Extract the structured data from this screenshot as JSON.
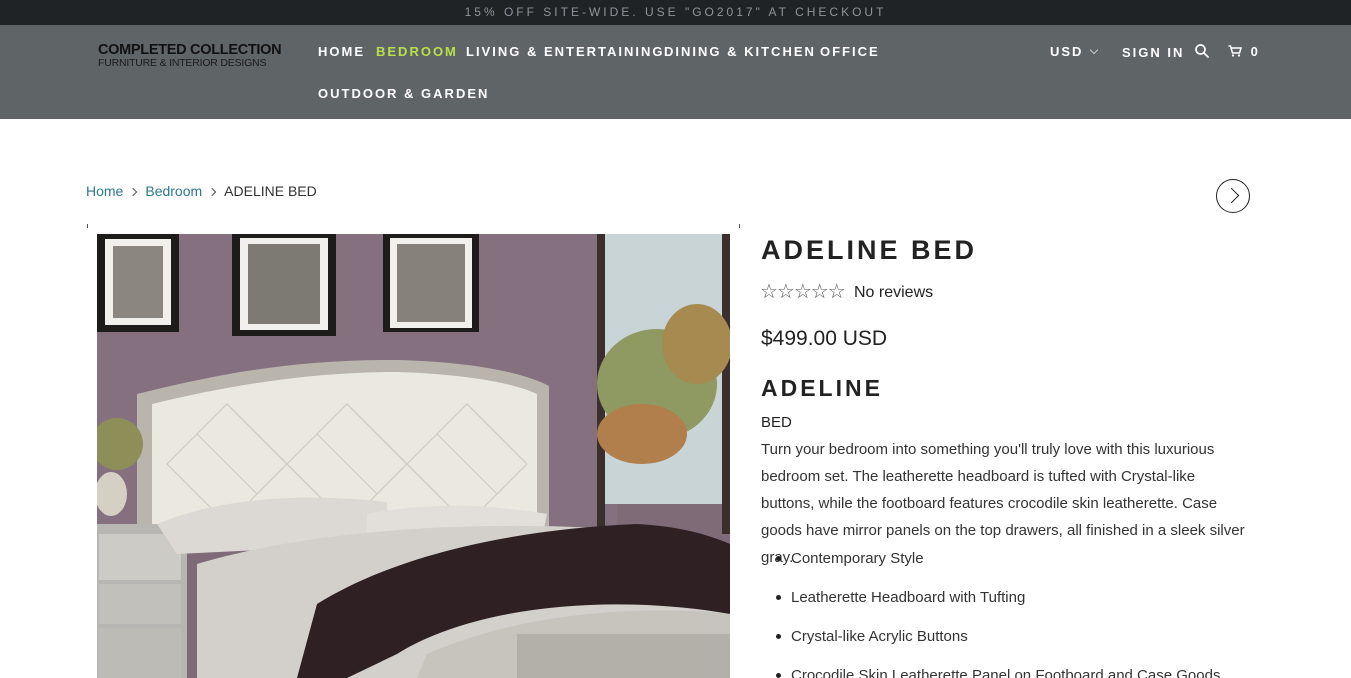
{
  "promo": {
    "text": "15% OFF SITE-WIDE. USE \"GO2017\" AT CHECKOUT"
  },
  "logo": {
    "main": "COMPLETED COLLECTION",
    "sub": "FURNITURE & INTERIOR DESIGNS"
  },
  "nav": {
    "items": [
      {
        "label": "HOME"
      },
      {
        "label": "BEDROOM",
        "active": true
      },
      {
        "label": "LIVING & ENTERTAINING"
      },
      {
        "label": "DINING & KITCHEN"
      },
      {
        "label": "OFFICE"
      },
      {
        "label": "OUTDOOR & GARDEN"
      }
    ],
    "active_color": "#b8e04a"
  },
  "header_right": {
    "currency": "USD",
    "sign_in": "SIGN IN",
    "search_icon": "search-icon",
    "cart_icon": "cart-icon",
    "cart_count": "0"
  },
  "breadcrumb": {
    "items": [
      {
        "label": "Home"
      },
      {
        "label": "Bedroom"
      }
    ],
    "current": "ADELINE BED"
  },
  "product": {
    "title": "ADELINE BED",
    "rating_stars": "☆☆☆☆☆",
    "rating_value": 0,
    "reviews_label": "No reviews",
    "price": "$499.00 USD",
    "subtitle": "ADELINE",
    "type": "BED",
    "description": "Turn your bedroom into something you'll truly love with this luxurious bedroom set. The leatherette headboard is tufted with Crystal-like buttons, while the footboard features crocodile skin leatherette. Case goods have mirror panels on the top drawers, all finished in a sleek silver gray.",
    "features": [
      "Contemporary Style",
      "Leatherette Headboard with Tufting",
      "Crystal-like Acrylic Buttons",
      "Crocodile Skin Leatherette Panel on Footboard and Case Goods"
    ]
  },
  "colors": {
    "promo_bg": "#1f2326",
    "header_bg": "#5f6467",
    "link": "#2c7a8c"
  }
}
